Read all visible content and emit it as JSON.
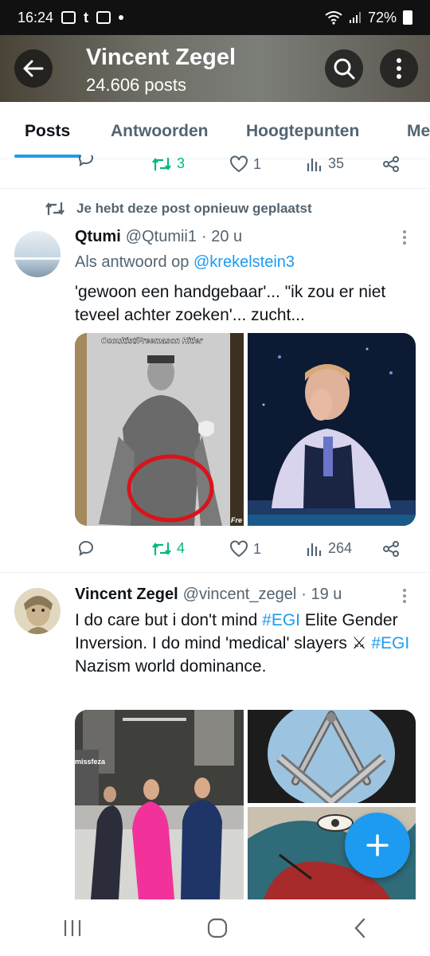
{
  "status_bar": {
    "time": "16:24",
    "battery": "72%"
  },
  "header": {
    "title": "Vincent Zegel",
    "subtitle": "24.606 posts"
  },
  "tabs": [
    {
      "label": "Posts"
    },
    {
      "label": "Antwoorden"
    },
    {
      "label": "Hoogtepunten"
    },
    {
      "label": "Me"
    }
  ],
  "prev_post": {
    "retweets": "3",
    "likes": "1",
    "views": "35"
  },
  "post1": {
    "repost_label": "Je hebt deze post opnieuw geplaatst",
    "name": "Qtumi",
    "handle": "@Qtumii1",
    "time": "· 20 u",
    "reply_prefix": "Als antwoord op",
    "reply_mention": "@krekelstein3",
    "text": "'gewoon een handgebaar'... \"ik zou er niet teveel achter zoeken'... zucht...",
    "image1_caption": "Occultist/Freemason Hitler",
    "image1_corner": "Fre",
    "retweets": "4",
    "likes": "1",
    "views": "264"
  },
  "post2": {
    "name": "Vincent Zegel",
    "handle": "@vincent_zegel",
    "time": "· 19 u",
    "text_1": "I do care but i don't mind ",
    "hashtag_1": "#EGI",
    "text_2": " Elite Gender Inversion. I do mind 'medical' slayers ",
    "emoji": "⚔",
    "text_3": " ",
    "hashtag_2": "#EGI",
    "text_4": " Nazism world dominance.",
    "image1_sign": "missfeza"
  },
  "colors": {
    "accent": "#1d9bf0",
    "retweet": "#00ba7c",
    "muted": "#536471"
  }
}
